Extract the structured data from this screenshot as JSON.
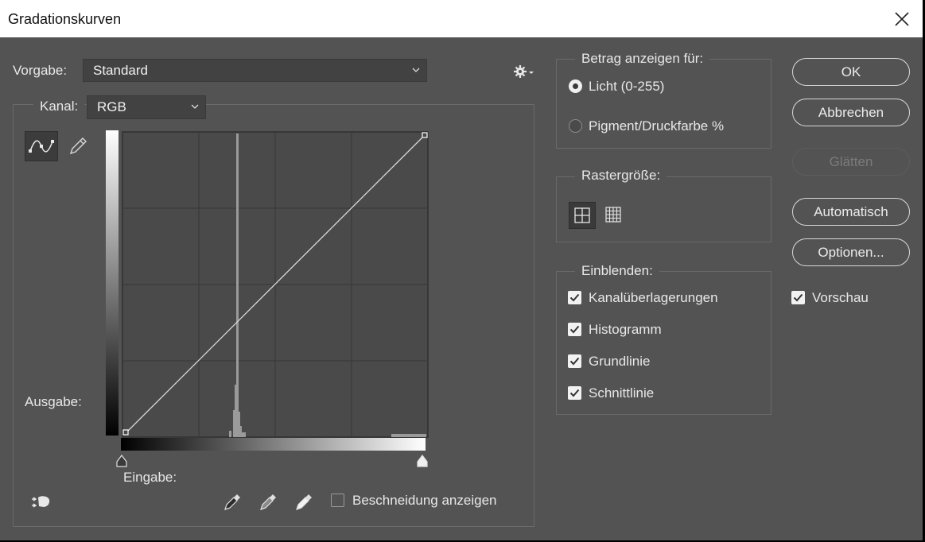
{
  "window": {
    "title": "Gradationskurven"
  },
  "preset": {
    "label": "Vorgabe:",
    "value": "Standard"
  },
  "channel": {
    "label": "Kanal:",
    "value": "RGB"
  },
  "curve": {
    "output_label": "Ausgabe:",
    "input_label": "Eingabe:",
    "show_clipping_label": "Beschneidung anzeigen",
    "show_clipping_checked": false
  },
  "show_amount": {
    "legend": "Betrag anzeigen für:",
    "options": [
      {
        "label": "Licht (0-255)",
        "selected": true
      },
      {
        "label": "Pigment/Druckfarbe %",
        "selected": false
      }
    ]
  },
  "grid_size": {
    "legend": "Rastergröße:"
  },
  "show": {
    "legend": "Einblenden:",
    "items": [
      {
        "label": "Kanalüberlagerungen",
        "checked": true
      },
      {
        "label": "Histogramm",
        "checked": true
      },
      {
        "label": "Grundlinie",
        "checked": true
      },
      {
        "label": "Schnittlinie",
        "checked": true
      }
    ]
  },
  "buttons": {
    "ok": "OK",
    "cancel": "Abbrechen",
    "smooth": "Glätten",
    "auto": "Automatisch",
    "options": "Optionen..."
  },
  "preview": {
    "label": "Vorschau",
    "checked": true
  },
  "colors": {
    "panel": "#535353",
    "graph_bg": "#4a4a4a",
    "titlebar": "#ffffff"
  }
}
